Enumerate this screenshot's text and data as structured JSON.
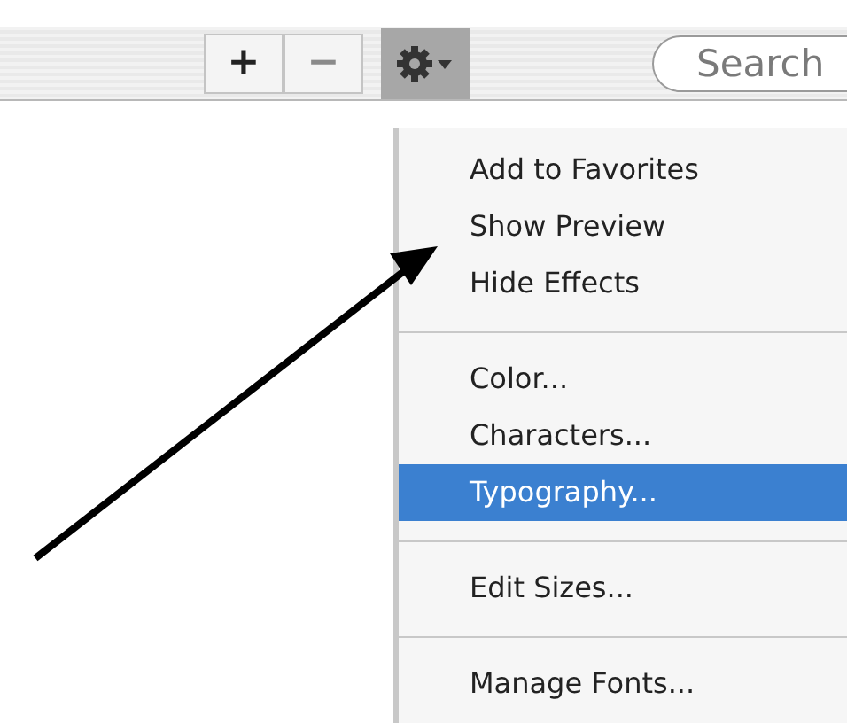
{
  "toolbar": {
    "buttons": [
      {
        "label": "+",
        "disabled": false
      },
      {
        "label": "−",
        "disabled": true
      }
    ],
    "action_menu_button": {
      "pressed": true
    },
    "search": {
      "placeholder": "Search"
    }
  },
  "action_menu": {
    "items": [
      {
        "kind": "item",
        "label": "Add to Favorites",
        "selected": false
      },
      {
        "kind": "item",
        "label": "Show Preview",
        "selected": false
      },
      {
        "kind": "item",
        "label": "Hide Effects",
        "selected": false
      },
      {
        "kind": "separator"
      },
      {
        "kind": "item",
        "label": "Color...",
        "selected": false
      },
      {
        "kind": "item",
        "label": "Characters...",
        "selected": false
      },
      {
        "kind": "item",
        "label": "Typography...",
        "selected": true
      },
      {
        "kind": "separator"
      },
      {
        "kind": "item",
        "label": "Edit Sizes...",
        "selected": false
      },
      {
        "kind": "separator"
      },
      {
        "kind": "item",
        "label": "Manage Fonts...",
        "selected": false
      }
    ]
  }
}
